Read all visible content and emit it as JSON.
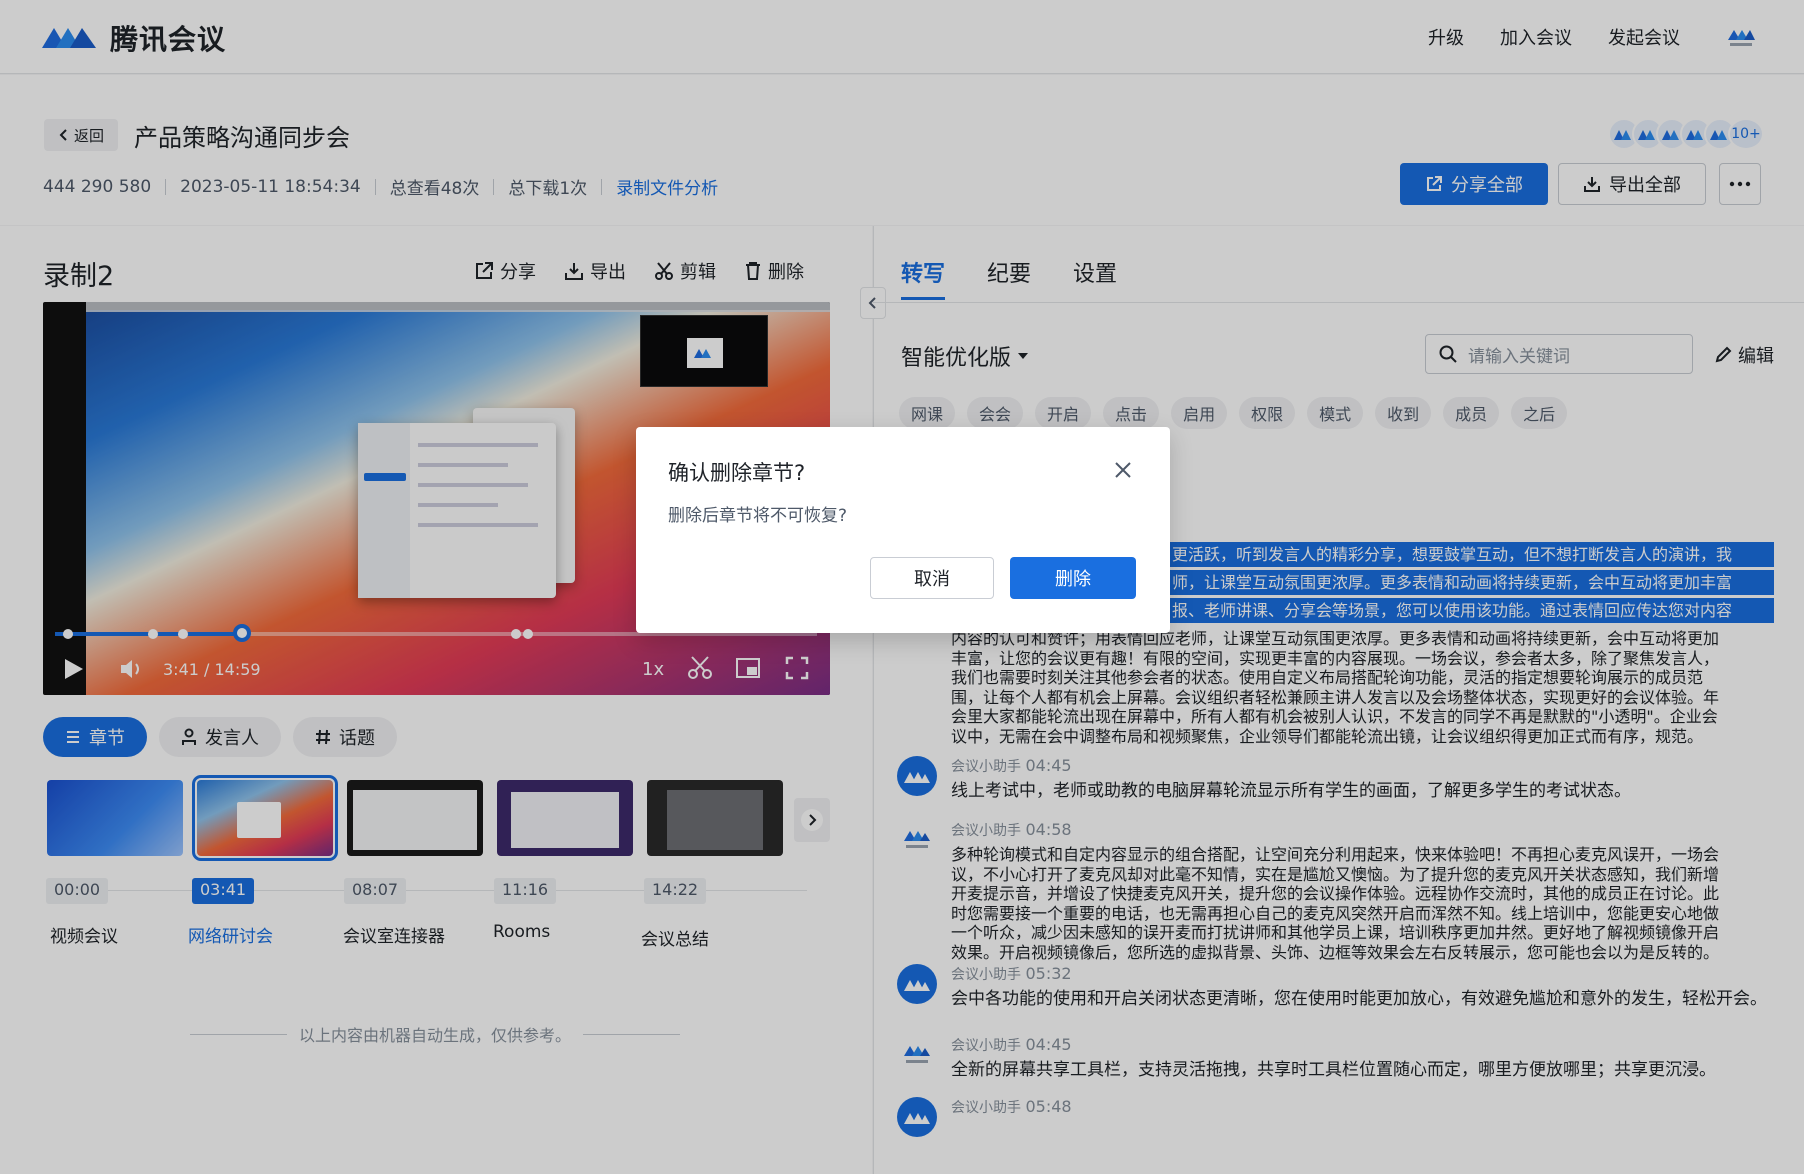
{
  "app": {
    "name": "腾讯会议"
  },
  "topnav": {
    "upgrade": "升级",
    "join": "加入会议",
    "start": "发起会议"
  },
  "header": {
    "back": "返回",
    "title": "产品策略沟通同步会",
    "meeting_id": "444 290 580",
    "datetime": "2023-05-11 18:54:34",
    "views": "总查看48次",
    "downloads": "总下载1次",
    "analysis_link": "录制文件分析",
    "participants_more": "10+",
    "share_all": "分享全部",
    "export_all": "导出全部"
  },
  "recording": {
    "title": "录制2",
    "tools": {
      "share": "分享",
      "export": "导出",
      "edit": "剪辑",
      "delete": "删除"
    },
    "player": {
      "current_time": "3:41",
      "duration": "14:59",
      "speed": "1x",
      "progress": 0.246
    }
  },
  "segments": {
    "chapters": "章节",
    "speakers": "发言人",
    "topics": "话题"
  },
  "chapters": [
    {
      "time": "00:00",
      "label": "视频会议"
    },
    {
      "time": "03:41",
      "label": "网络研讨会"
    },
    {
      "time": "08:07",
      "label": "会议室连接器"
    },
    {
      "time": "11:16",
      "label": "Rooms"
    },
    {
      "time": "14:22",
      "label": "会议总结"
    }
  ],
  "disclaimer": "以上内容由机器自动生成，仅供参考。",
  "right": {
    "tabs": {
      "transcript": "转写",
      "summary": "纪要",
      "settings": "设置"
    },
    "mode": "智能优化版",
    "search_placeholder": "请输入关键词",
    "edit": "编辑",
    "keywords": [
      "网课",
      "会会",
      "开启",
      "点击",
      "启用",
      "权限",
      "模式",
      "收到",
      "成员",
      "之后"
    ]
  },
  "transcript": {
    "highlight": [
      "更活跃，听到发言人的精彩分享，想要鼓掌互动，但不想打断发言人的演讲，我",
      "师，让课堂互动氛围更浓厚。更多表情和动画将持续更新，会中互动将更加丰富",
      "报、老师讲课、分享会等场景，您可以使用该功能。通过表情回应传达您对内容"
    ],
    "para0": [
      "内容的认可和赞许；用表情回应老师，让课堂互动氛围更浓厚。更多表情和动画将持续更新，会中互动将更加",
      "丰富，让您的会议更有趣！有限的空间，实现更丰富的内容展现。一场会议，参会者太多，除了聚焦发言人，",
      "我们也需要时刻关注其他参会者的状态。使用自定义布局搭配轮询功能，灵活的指定想要轮询展示的成员范",
      "围，让每个人都有机会上屏幕。会议组织者轻松兼顾主讲人发言以及会场整体状态，实现更好的会议体验。年",
      "会里大家都能轮流出现在屏幕中，所有人都有机会被别人认识，不发言的同学不再是默默的\"小透明\"。企业会",
      "议中，无需在会中调整布局和视频聚焦，企业领导们都能轮流出镜，让会议组织得更加正式而有序，规范。"
    ],
    "entries": [
      {
        "speaker": "会议小助手",
        "time": "04:45",
        "lines": [
          "线上考试中，老师或助教的电脑屏幕轮流显示所有学生的画面，了解更多学生的考试状态。"
        ]
      },
      {
        "speaker": "会议小助手",
        "time": "04:58",
        "lines": [
          "多种轮询模式和自定内容显示的组合搭配，让空间充分利用起来，快来体验吧！不再担心麦克风误开，一场会",
          "议，不小心打开了麦克风却对此毫不知情，实在是尴尬又懊恼。为了提升您的麦克风开关状态感知，我们新增",
          "开麦提示音，并增设了快捷麦克风开关，提升您的会议操作体验。远程协作交流时，其他的成员正在讨论。此",
          "时您需要接一个重要的电话，也无需再担心自己的麦克风突然开启而浑然不知。线上培训中，您能更安心地做",
          "一个听众，减少因未感知的误开麦而打扰讲师和其他学员上课，培训秩序更加井然。更好地了解视频镜像开启",
          "效果。开启视频镜像后，您所选的虚拟背景、头饰、边框等效果会左右反转展示，您可能也会以为是反转的。"
        ]
      },
      {
        "speaker": "会议小助手",
        "time": "05:32",
        "lines": [
          "会中各功能的使用和开启关闭状态更清晰，您在使用时能更加放心，有效避免尴尬和意外的发生，轻松开会。"
        ]
      },
      {
        "speaker": "会议小助手",
        "time": "04:45",
        "lines": [
          "全新的屏幕共享工具栏，支持灵活拖拽，共享时工具栏位置随心而定，哪里方便放哪里；共享更沉浸。"
        ]
      },
      {
        "speaker": "会议小助手",
        "time": "05:48",
        "lines": []
      }
    ]
  },
  "modal": {
    "title": "确认删除章节?",
    "body": "删除后章节将不可恢复?",
    "cancel": "取消",
    "confirm": "删除"
  },
  "colors": {
    "brand": "#1a6fe0",
    "text": "#1f2329",
    "muted": "#86909c"
  }
}
